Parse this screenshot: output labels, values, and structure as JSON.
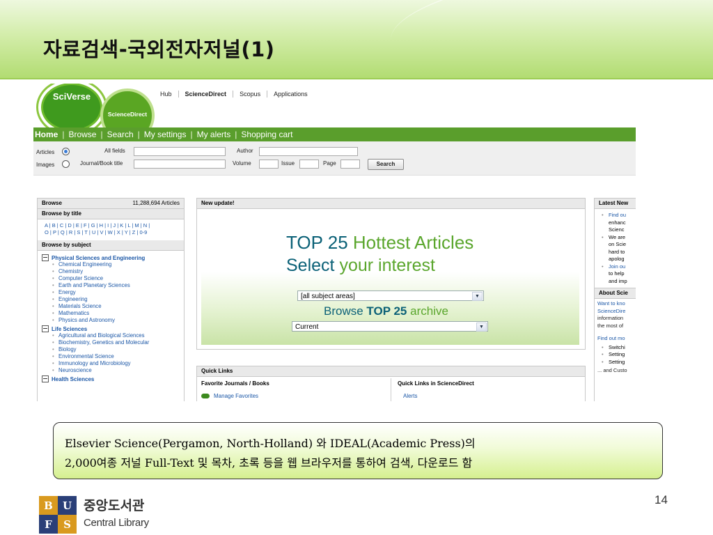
{
  "slide": {
    "title": "자료검색-국외전자저널(1)",
    "page_number": "14"
  },
  "screenshot": {
    "logos": {
      "sciverse": "SciVerse",
      "sciencedirect": "ScienceDirect"
    },
    "top_links": [
      "Hub",
      "ScienceDirect",
      "Scopus",
      "Applications"
    ],
    "nav": [
      "Home",
      "Browse",
      "Search",
      "My settings",
      "My alerts",
      "Shopping cart"
    ],
    "search": {
      "articles_label": "Articles",
      "images_label": "Images",
      "all_fields_label": "All fields",
      "journal_label": "Journal/Book title",
      "author_label": "Author",
      "volume_label": "Volume",
      "issue_label": "Issue",
      "page_label": "Page",
      "search_button": "Search"
    },
    "browse": {
      "header": "Browse",
      "count": "11,288,694 Articles",
      "by_title": "Browse by title",
      "alpha_line1": "A | B | C | D | E | F | G | H | I | J | K | L | M | N |",
      "alpha_line2": "O | P | Q | R | S | T | U | V | W | X | Y | Z | 0-9",
      "by_subject": "Browse by subject",
      "groups": [
        {
          "name": "Physical Sciences and Engineering",
          "items": [
            "Chemical Engineering",
            "Chemistry",
            "Computer Science",
            "Earth and Planetary Sciences",
            "Energy",
            "Engineering",
            "Materials Science",
            "Mathematics",
            "Physics and Astronomy"
          ]
        },
        {
          "name": "Life Sciences",
          "items": [
            "Agricultural and Biological Sciences",
            "Biochemistry, Genetics and Molecular",
            "Biology",
            "Environmental Science",
            "Immunology and Microbiology",
            "Neuroscience"
          ]
        },
        {
          "name": "Health Sciences",
          "items": []
        }
      ]
    },
    "update": {
      "header": "New update!",
      "line1_a": "TOP 25",
      "line1_b": "Hottest Articles",
      "line2_a": "Select",
      "line2_b": "your interest",
      "subject_select": "[all subject areas]",
      "browse_a": "Browse",
      "browse_b": "TOP 25",
      "browse_c": "archive",
      "period_select": "Current"
    },
    "quick_links": {
      "header": "Quick Links",
      "favorites": "Favorite Journals / Books",
      "favorites_link": "Manage Favorites",
      "in_sd": "Quick Links in ScienceDirect",
      "alerts": "Alerts"
    },
    "latest": {
      "header": "Latest New",
      "items": [
        "Find ou",
        "enhanc",
        "Scienc",
        "We are",
        "on Scie",
        "hard to",
        "apolog",
        "Join ou",
        "to help",
        "and imp"
      ],
      "about_header": "About Scie",
      "about_lines": [
        "Want to kno",
        "ScienceDire",
        "information",
        "the most of"
      ],
      "find_out": "Find out mo",
      "find_items": [
        "Switchi",
        "Setting",
        "Setting"
      ],
      "and_custom": "... and Custo"
    }
  },
  "callout": {
    "line1": "Elsevier Science(Pergamon, North-Holland) 와 IDEAL(Academic Press)의",
    "line2": "2,000여종 저널 Full-Text 및 목차, 초록 등을 웹 브라우저를 통하여 검색, 다운로드 함"
  },
  "library_logo": {
    "letters": [
      "B",
      "U",
      "F",
      "S"
    ],
    "name_ko": "중앙도서관",
    "name_en": "Central Library"
  },
  "colors": {
    "sd_green": "#5a9e2c",
    "link_blue": "#1a56a6",
    "logo_gold": "#d99a1f",
    "logo_navy": "#2a3f78"
  }
}
